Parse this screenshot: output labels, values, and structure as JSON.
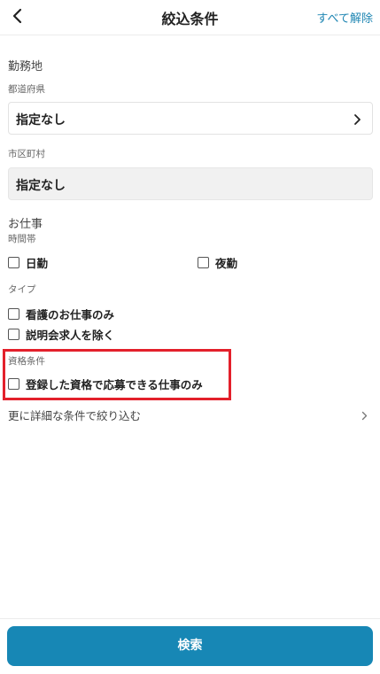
{
  "header": {
    "title": "絞込条件",
    "clear_all_label": "すべて解除"
  },
  "location": {
    "section_title": "勤務地",
    "prefecture": {
      "label": "都道府県",
      "value": "指定なし"
    },
    "city": {
      "label": "市区町村",
      "value": "指定なし"
    }
  },
  "job": {
    "section_title": "お仕事",
    "time_slot": {
      "label": "時間帯",
      "options": [
        {
          "label": "日勤",
          "checked": false
        },
        {
          "label": "夜勤",
          "checked": false
        }
      ]
    },
    "type": {
      "label": "タイプ",
      "options": [
        {
          "label": "看護のお仕事のみ",
          "checked": false
        },
        {
          "label": "説明会求人を除く",
          "checked": false
        }
      ]
    },
    "qualification": {
      "label": "資格条件",
      "options": [
        {
          "label": "登録した資格で応募できる仕事のみ",
          "checked": false
        }
      ]
    }
  },
  "more_filters_label": "更に詳細な条件で絞り込む",
  "footer": {
    "search_label": "検索"
  },
  "colors": {
    "accent": "#1787b5",
    "link": "#1f86b3",
    "highlight": "#e3202b"
  }
}
